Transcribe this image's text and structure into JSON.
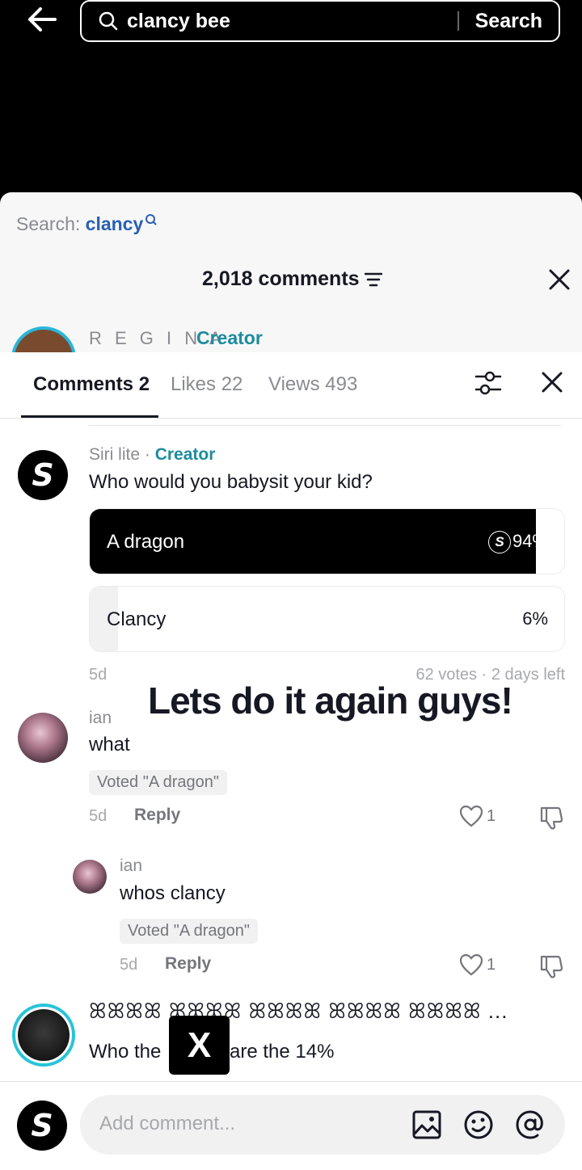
{
  "top": {
    "query": "clancy bee",
    "search_label": "Search"
  },
  "sheet": {
    "search_prefix": "Search: ",
    "search_term": "clancy",
    "comment_count": "2,018 comments",
    "regina_name": "R E G I N A ·",
    "regina_creator": "Creator"
  },
  "tabs": {
    "comments": "Comments 2",
    "likes": "Likes 22",
    "views": "Views 493"
  },
  "poll_comment": {
    "name": "Siri lite · ",
    "creator": "Creator",
    "text": "Who would you babysit your kid?",
    "options": [
      {
        "label": "A dragon",
        "pct": "94%",
        "fraction": 0.94
      },
      {
        "label": "Clancy",
        "pct": "6%",
        "fraction": 0.06
      }
    ],
    "age": "5d",
    "stats": "62 votes · 2 days left"
  },
  "overlay_caption": "Lets do it again guys!",
  "comments": [
    {
      "name": "ian",
      "text": "what",
      "voted": "Voted \"A dragon\"",
      "age": "5d",
      "reply": "Reply",
      "likes": "1"
    },
    {
      "name": "ian",
      "text": "whos clancy",
      "voted": "Voted \"A dragon\"",
      "age": "5d",
      "reply": "Reply",
      "likes": "1"
    }
  ],
  "last_comment": {
    "name": "ꕤꕤꕤꕤ ꕤꕤꕤꕤ ꕤꕤꕤꕤ ꕤꕤꕤꕤ ꕤꕤꕤꕤ ...",
    "text_left": "Who the",
    "text_right": "are the 14%",
    "badge": "X"
  },
  "bottom": {
    "placeholder": "Add comment..."
  },
  "colors": {
    "accent_teal": "#1d8c9e",
    "ring": "#29c4d8",
    "link_blue": "#2b5fb4"
  }
}
